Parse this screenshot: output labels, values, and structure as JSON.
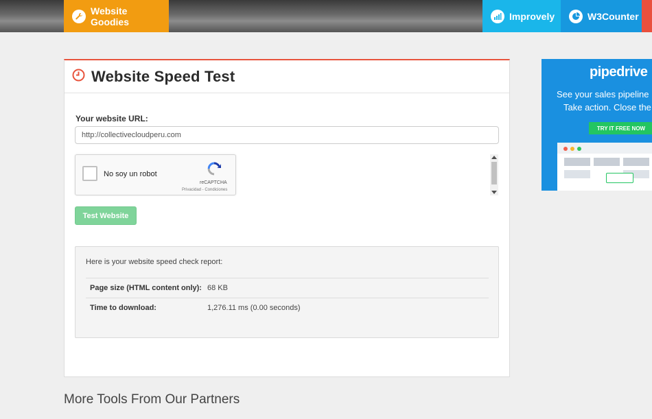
{
  "nav": {
    "goodies_label": "Website Goodies",
    "improvely_label": "Improvely",
    "w3counter_label": "W3Counter"
  },
  "card": {
    "title": "Website Speed Test",
    "url_label": "Your website URL:",
    "url_value": "http://collectivecloudperu.com",
    "captcha": {
      "text": "No soy un robot",
      "brand": "reCAPTCHA",
      "links": "Privacidad - Condiciones"
    },
    "test_button": "Test Website",
    "report": {
      "intro": "Here is your website speed check report:",
      "rows": [
        {
          "label": "Page size (HTML content only):",
          "value": "68 KB"
        },
        {
          "label": "Time to download:",
          "value": "1,276.11 ms (0.00 seconds)"
        }
      ]
    }
  },
  "more_tools": "More Tools From Our Partners",
  "ad": {
    "logo": "pipedrive",
    "line1": "See your sales pipeline",
    "line2": "Take action. Close the",
    "cta": "TRY IT FREE NOW"
  },
  "colors": {
    "goodies": "#f29c11",
    "improvely": "#1ab6ea",
    "w3counter": "#1798df",
    "accent_red": "#e8533c",
    "test_button": "#7fd49a",
    "ad_bg": "#1a90e0"
  }
}
